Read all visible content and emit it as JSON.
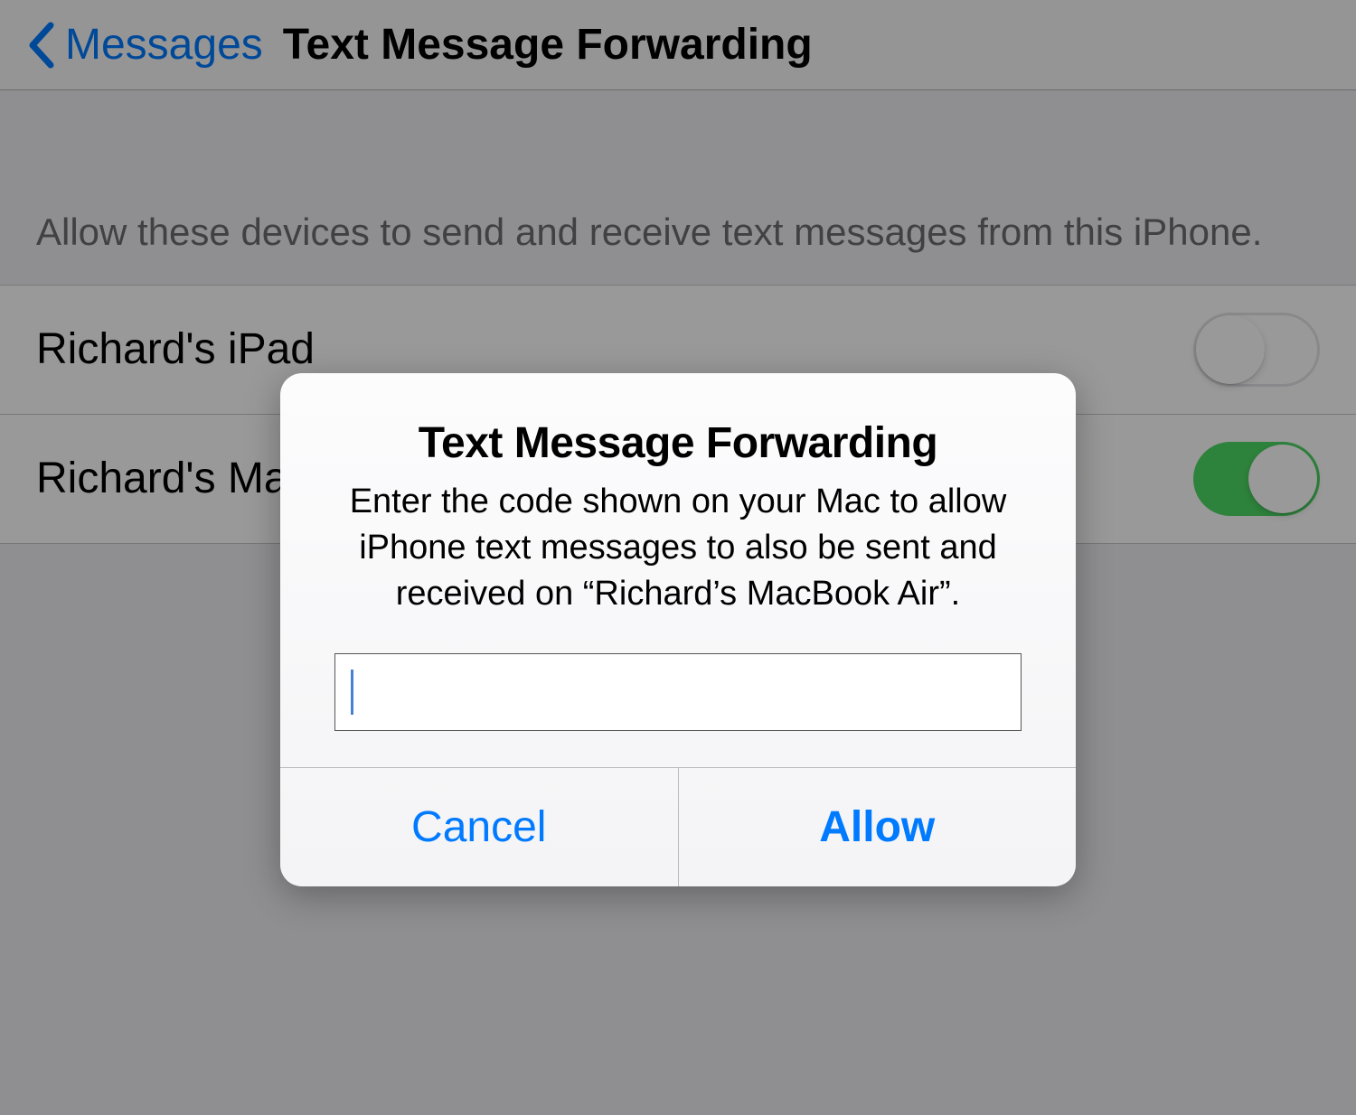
{
  "nav": {
    "back_label": "Messages",
    "title": "Text Message Forwarding"
  },
  "section_header": "Allow these devices to send and receive text messages from this iPhone.",
  "devices": [
    {
      "label": "Richard's iPad",
      "enabled": false
    },
    {
      "label": "Richard's MacBook Air",
      "enabled": true
    }
  ],
  "alert": {
    "title": "Text Message Forwarding",
    "message": "Enter the code shown on your Mac to allow iPhone text messages to also be sent and received on “Richard’s MacBook Air”.",
    "input_value": "",
    "cancel_label": "Cancel",
    "confirm_label": "Allow"
  }
}
